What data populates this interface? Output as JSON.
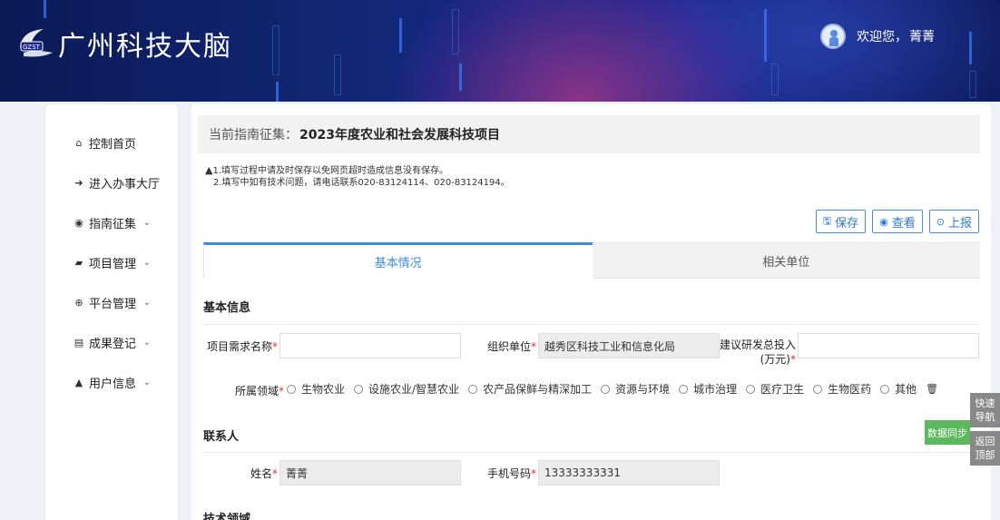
{
  "header": {
    "logo_badge": "GZST",
    "title": "广州科技大脑",
    "welcome": "欢迎您，",
    "username": "菁菁"
  },
  "sidebar": {
    "items": [
      {
        "label": "控制首页",
        "icon": "home-icon",
        "glyph": "⌂",
        "expandable": false
      },
      {
        "label": "进入办事大厅",
        "icon": "arrow-right-icon",
        "glyph": "➜",
        "expandable": false
      },
      {
        "label": "指南征集",
        "icon": "compass-icon",
        "glyph": "◉",
        "expandable": true
      },
      {
        "label": "项目管理",
        "icon": "folder-icon",
        "glyph": "▰",
        "expandable": true
      },
      {
        "label": "平台管理",
        "icon": "platform-icon",
        "glyph": "⊕",
        "expandable": true
      },
      {
        "label": "成果登记",
        "icon": "document-icon",
        "glyph": "▤",
        "expandable": true
      },
      {
        "label": "用户信息",
        "icon": "user-icon",
        "glyph": "▲",
        "expandable": true
      }
    ],
    "chevron": "⌄"
  },
  "main": {
    "guide_prefix": "当前指南征集：",
    "guide_title": "2023年度农业和社会发展科技项目",
    "notice_line1": "1.填写过程中请及时保存以免网页超时造成信息没有保存。",
    "notice_line2": "2.填写中如有技术问题，请电话联系020-83124114、020-83124194。",
    "warn_glyph": "▲",
    "buttons": {
      "save": "保存",
      "view": "查看",
      "submit": "上报"
    },
    "tabs": [
      "基本情况",
      "相关单位"
    ],
    "basic_info": {
      "title": "基本信息",
      "project_name_label": "项目需求名称",
      "project_name_value": "",
      "org_label": "组织单位",
      "org_value": "越秀区科技工业和信息化局",
      "invest_label_line1": "建议研发总投入",
      "invest_label_line2": "(万元)",
      "invest_value": "",
      "field_label": "所属领域",
      "field_options": [
        "生物农业",
        "设施农业/智慧农业",
        "农产品保鲜与精深加工",
        "资源与环境",
        "城市治理",
        "医疗卫生",
        "生物医药",
        "其他"
      ]
    },
    "contact": {
      "title": "联系人",
      "name_label": "姓名",
      "name_value": "菁菁",
      "phone_label": "手机号码",
      "phone_value": "13333333331"
    },
    "tech_title": "技术领域",
    "required_mark": "*"
  },
  "floating": {
    "sync": "数据同步",
    "quick_nav_1": "快速",
    "quick_nav_2": "导航",
    "back_top_1": "返回",
    "back_top_2": "顶部"
  },
  "colors": {
    "accent": "#3d8ae0",
    "required": "#e03030",
    "sync_green": "#5cb85c",
    "banner_dark": "#13287a"
  }
}
